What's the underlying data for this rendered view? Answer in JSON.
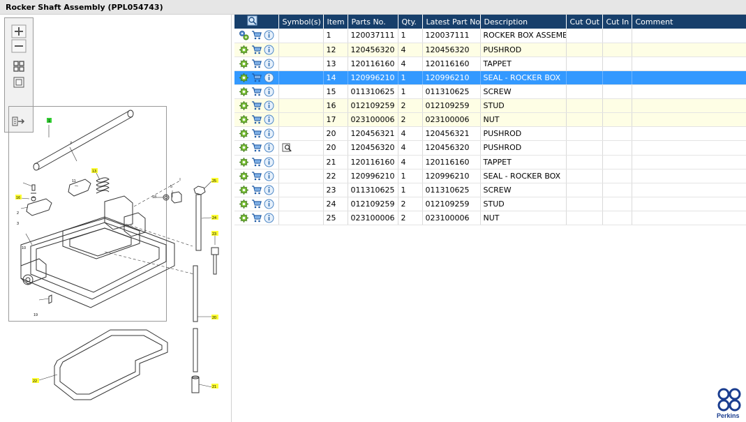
{
  "window": {
    "title": "Rocker Shaft Assembly (PPL054743)"
  },
  "colors": {
    "header_bg": "#173f6b",
    "selected_row": "#3399ff",
    "alt_row": "#fefee5",
    "callout_yellow": "#ffff33",
    "callout_green": "#33cc33",
    "brand": "#1a3d8f"
  },
  "toolbox": {
    "buttons": [
      "zoom-in-icon",
      "zoom-out-icon",
      "fit-all-icon",
      "fit-window-icon",
      "export-icon"
    ]
  },
  "diagram": {
    "callouts": [
      {
        "label": "1",
        "highlight": "green"
      },
      {
        "label": "7",
        "highlight": "none"
      },
      {
        "label": "13",
        "highlight": "yellow"
      },
      {
        "label": "11",
        "highlight": "none"
      },
      {
        "label": "5",
        "highlight": "none"
      },
      {
        "label": "25",
        "highlight": "yellow"
      },
      {
        "label": "16",
        "highlight": "yellow"
      },
      {
        "label": "18",
        "highlight": "none"
      },
      {
        "label": "2",
        "highlight": "none"
      },
      {
        "label": "3",
        "highlight": "none"
      },
      {
        "label": "24",
        "highlight": "yellow"
      },
      {
        "label": "23",
        "highlight": "yellow"
      },
      {
        "label": "10",
        "highlight": "none"
      },
      {
        "label": "19",
        "highlight": "none"
      },
      {
        "label": "20",
        "highlight": "yellow"
      },
      {
        "label": "22",
        "highlight": "yellow"
      },
      {
        "label": "21",
        "highlight": "yellow"
      }
    ]
  },
  "table": {
    "columns": [
      "",
      "Symbol(s)",
      "Item",
      "Parts No.",
      "Qty.",
      "Latest Part No.",
      "Description",
      "Cut Out",
      "Cut In",
      "Comment"
    ],
    "row_icons": [
      "gear-icon",
      "cart-icon",
      "info-icon"
    ],
    "rows": [
      {
        "item": "1",
        "part_no": "120037111",
        "qty": "1",
        "latest": "120037111",
        "desc": "ROCKER BOX ASSEMBLY",
        "symbol": "",
        "style": "normal",
        "multi_gear": true
      },
      {
        "item": "12",
        "part_no": "120456320",
        "qty": "4",
        "latest": "120456320",
        "desc": "PUSHROD",
        "symbol": "",
        "style": "alt",
        "multi_gear": false
      },
      {
        "item": "13",
        "part_no": "120116160",
        "qty": "4",
        "latest": "120116160",
        "desc": "TAPPET",
        "symbol": "",
        "style": "normal",
        "multi_gear": false
      },
      {
        "item": "14",
        "part_no": "120996210",
        "qty": "1",
        "latest": "120996210",
        "desc": "SEAL - ROCKER BOX",
        "symbol": "",
        "style": "sel",
        "multi_gear": false
      },
      {
        "item": "15",
        "part_no": "011310625",
        "qty": "1",
        "latest": "011310625",
        "desc": "SCREW",
        "symbol": "",
        "style": "normal",
        "multi_gear": false
      },
      {
        "item": "16",
        "part_no": "012109259",
        "qty": "2",
        "latest": "012109259",
        "desc": "STUD",
        "symbol": "",
        "style": "alt",
        "multi_gear": false
      },
      {
        "item": "17",
        "part_no": "023100006",
        "qty": "2",
        "latest": "023100006",
        "desc": "NUT",
        "symbol": "",
        "style": "alt",
        "multi_gear": false
      },
      {
        "item": "20",
        "part_no": "120456321",
        "qty": "4",
        "latest": "120456321",
        "desc": "PUSHROD",
        "symbol": "",
        "style": "normal",
        "multi_gear": false
      },
      {
        "item": "20",
        "part_no": "120456320",
        "qty": "4",
        "latest": "120456320",
        "desc": "PUSHROD",
        "symbol": "zoom-page-icon",
        "style": "normal",
        "multi_gear": false
      },
      {
        "item": "21",
        "part_no": "120116160",
        "qty": "4",
        "latest": "120116160",
        "desc": "TAPPET",
        "symbol": "",
        "style": "normal",
        "multi_gear": false
      },
      {
        "item": "22",
        "part_no": "120996210",
        "qty": "1",
        "latest": "120996210",
        "desc": "SEAL - ROCKER BOX",
        "symbol": "",
        "style": "normal",
        "multi_gear": false
      },
      {
        "item": "23",
        "part_no": "011310625",
        "qty": "1",
        "latest": "011310625",
        "desc": "SCREW",
        "symbol": "",
        "style": "normal",
        "multi_gear": false
      },
      {
        "item": "24",
        "part_no": "012109259",
        "qty": "2",
        "latest": "012109259",
        "desc": "STUD",
        "symbol": "",
        "style": "normal",
        "multi_gear": false
      },
      {
        "item": "25",
        "part_no": "023100006",
        "qty": "2",
        "latest": "023100006",
        "desc": "NUT",
        "symbol": "",
        "style": "normal",
        "multi_gear": false
      }
    ]
  },
  "brand": {
    "logo_text": "Perkins"
  }
}
